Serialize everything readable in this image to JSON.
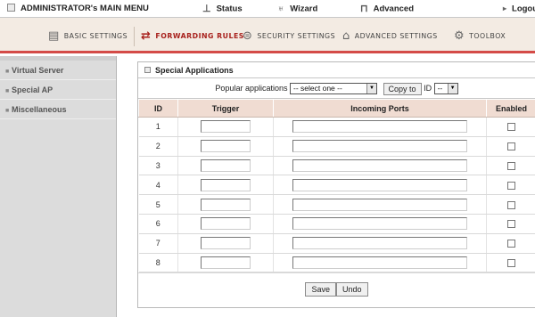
{
  "topmenu": {
    "admin_title": "ADMINISTRATOR's MAIN MENU",
    "status": "Status",
    "wizard": "Wizard",
    "advanced": "Advanced",
    "logout": "Logout"
  },
  "tabs": [
    {
      "label": "BASIC SETTINGS",
      "icon": "folder-icon"
    },
    {
      "label": "FORWARDING RULES",
      "icon": "forward-arrows-icon",
      "active": true
    },
    {
      "label": "SECURITY SETTINGS",
      "icon": "shield-icon"
    },
    {
      "label": "ADVANCED SETTINGS",
      "icon": "advanced-icon"
    },
    {
      "label": "TOOLBOX",
      "icon": "toolbox-icon"
    }
  ],
  "sidebar": {
    "items": [
      {
        "label": "Virtual Server"
      },
      {
        "label": "Special AP"
      },
      {
        "label": "Miscellaneous"
      }
    ]
  },
  "panel": {
    "title": "Special Applications",
    "popular_label": "Popular applications",
    "popular_select": "-- select one --",
    "copy_to_label": "Copy to",
    "id_label": "ID",
    "id_select": "--"
  },
  "table": {
    "headers": [
      "ID",
      "Trigger",
      "Incoming Ports",
      "Enabled"
    ],
    "rows": [
      {
        "id": "1"
      },
      {
        "id": "2"
      },
      {
        "id": "3"
      },
      {
        "id": "4"
      },
      {
        "id": "5"
      },
      {
        "id": "6"
      },
      {
        "id": "7"
      },
      {
        "id": "8"
      }
    ]
  },
  "actions": {
    "save_label": "Save",
    "undo_label": "Undo"
  },
  "colors": {
    "accent": "#d44b47",
    "tab_bar_bg": "#f3ebe3",
    "header_row_bg": "#f0dcd2",
    "sidebar_bg": "#dcdcdc"
  }
}
